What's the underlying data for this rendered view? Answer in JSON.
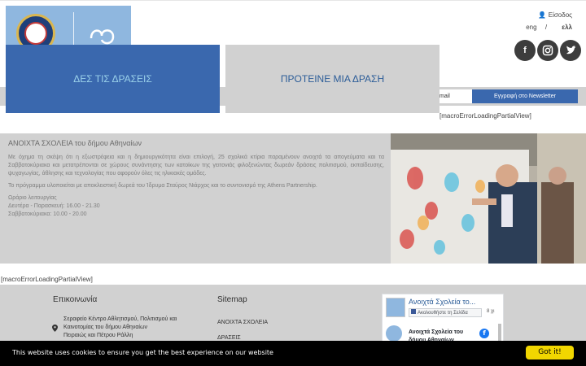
{
  "header": {
    "login_label": "Είσοδος",
    "lang_eng": "eng",
    "lang_separator": "/",
    "lang_ell": "ελλ",
    "social": {
      "facebook_icon": "facebook-icon",
      "instagram_icon": "instagram-icon",
      "twitter_icon": "twitter-icon"
    }
  },
  "cta": {
    "see_actions": "ΔΕΣ ΤΙΣ ΔΡΑΣΕΙΣ",
    "propose_action": "ΠΡΟΤΕΙΝΕ ΜΙΑ ΔΡΑΣΗ"
  },
  "newsletter": {
    "input_value": "mail",
    "button_label": "Εγγραφή στο Newsletter"
  },
  "errors": {
    "macro_error_1": "[macroErrorLoadingPartialView]",
    "macro_error_2": "[macroErrorLoadingPartialView]"
  },
  "intro": {
    "title": "ΑΝΟΙΧΤΑ ΣΧΟΛΕΙΑ του δήμου Αθηναίων",
    "paragraph_1": "Με όχημα τη σκέψη ότι η εξωστρέφεια και η δημιουργικότητα είναι επιλογή, 25 σχολικά κτίρια παραμένουν ανοιχτά τα απογεύματα και τα Σαββατοκύριακα και μετατρέπονται σε χώρους συνάντησης των κατοίκων της γειτονιάς φιλοξενώντας δωρεάν δράσεις πολιτισμού, εκπαίδευσης, ψυχαγωγίας, άθλησης και τεχνολογίας που αφορούν όλες τις ηλικιακές ομάδες.",
    "paragraph_2": "Το πρόγραμμα υλοποιείται με αποκλειστική δωρεά του Ίδρυμα Σταύρος Νιάρχος και το συντονισμό της Athens Partnership.",
    "hours_title": "Ωράριο λειτουργίας",
    "hours_weekdays": "Δευτέρα - Παρασκευή: 16.00 - 21.30",
    "hours_weekend": "Σαββατοκύριακα: 10.00 - 20.00"
  },
  "footer": {
    "contact_title": "Επικοινωνία",
    "address_lines": [
      "Σεραφείο Κέντρο Αθλητισμού, Πολιτισμού και",
      "Καινοτομίας του δήμου Αθηναίων",
      "Πειραιώς και Πέτρου Ράλλη"
    ],
    "sitemap_title": "Sitemap",
    "sitemap_links": [
      "ΑΝΟΙΧΤΑ ΣΧΟΛΕΙΑ",
      "ΔΡΑΣΕΙΣ"
    ]
  },
  "facebook_widget": {
    "page_name": "Ανοιχτά Σχολεία το...",
    "follow_label": "Ακολουθήστε τη Σελίδα",
    "follower_count": "8 χι",
    "post_author": "Ανοιχτά Σχολεία του",
    "post_author_line2": "δήμου Αθηναίων"
  },
  "cookie": {
    "message": "This website uses cookies to ensure you get the best experience on our website",
    "button_label": "Got it!"
  },
  "colors": {
    "brand_blue": "#3a68ae",
    "light_blue": "#8fb7df",
    "panel_gray": "#d1d1d1",
    "cookie_bg": "#000000",
    "cookie_button": "#f1d600"
  }
}
